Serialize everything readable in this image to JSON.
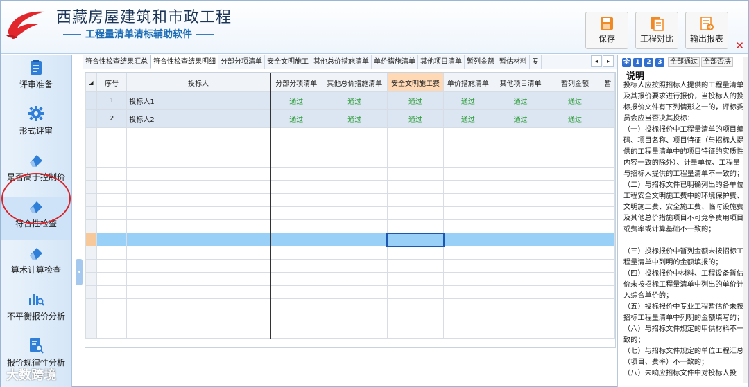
{
  "app": {
    "title": "西藏房屋建筑和市政工程",
    "subtitle": "工程量清单清标辅助软件"
  },
  "toolbar": {
    "save_label": "保存",
    "compare_label": "工程对比",
    "export_label": "输出报表",
    "close_label": "✕"
  },
  "sidebar": {
    "items": [
      {
        "label": "评审准备",
        "icon": "clipboard-icon"
      },
      {
        "label": "形式评审",
        "icon": "gear-icon"
      },
      {
        "label": "是否高于控制价",
        "icon": "eraser-icon"
      },
      {
        "label": "符合性检查",
        "icon": "eraser-icon"
      },
      {
        "label": "算术计算检查",
        "icon": "eraser-icon"
      },
      {
        "label": "不平衡报价分析",
        "icon": "bar-chart-search-icon"
      },
      {
        "label": "报价规律性分析",
        "icon": "document-search-icon"
      }
    ]
  },
  "tabs": [
    "符合性检查结果汇总",
    "符合性检查结果明细",
    "分部分项清单",
    "安全文明施工",
    "其他总价措施清单",
    "单价措施清单",
    "其他项目清单",
    "暂列金额",
    "暂估材料",
    "专"
  ],
  "tab_scroll": {
    "left": "◂",
    "right": "▸"
  },
  "grid": {
    "corner": "◢",
    "columns": [
      "序号",
      "投标人",
      "分部分项清单",
      "其他总价措施清单",
      "安全文明施工费",
      "单价措施清单",
      "其他项目清单",
      "暂列金额",
      "暂"
    ],
    "rows": [
      {
        "no": "1",
        "bidder": "投标人1",
        "cells": [
          "通过",
          "通过",
          "通过",
          "通过",
          "通过",
          "通过"
        ]
      },
      {
        "no": "2",
        "bidder": "投标人2",
        "cells": [
          "通过",
          "通过",
          "通过",
          "通过",
          "通过",
          "通过"
        ]
      }
    ]
  },
  "right_panel": {
    "pages": [
      "全",
      "1",
      "2",
      "3"
    ],
    "all_pass": "全部通过",
    "all_reject": "全部否决",
    "title": "说明",
    "paragraphs": [
      "投标人应按照招标人提供的工程量清单及其报价要求进行报价，当投标人的投标报价文件有下列情形之一的，评标委员会应当否决其投标：",
      "（一）投标报价中工程量清单的项目编码、项目名称、项目特征（与招标人提供的工程量清单中的项目特征的实质性内容一致的除外）、计量单位、工程量与招标人提供的工程量清单不一致的；",
      "（二）与招标文件已明确列出的各单位工程安全文明施工费中的环境保护费、文明施工费、安全施工费、临时设施费及其他总价措施项目不可竞争费用项目或费率或计算基础不一致的；",
      "（三）投标报价中暂列金额未按招标工程量清单中列明的金额填报的；",
      "（四）投标报价中材料、工程设备暂估价未按招标工程量清单中列出的单价计入综合单价的；",
      "（五）投标报价中专业工程暂估价未按招标工程量清单中列明的金额填写的；",
      "（六）与招标文件规定的甲供材料不一致的；",
      "（七）与招标文件规定的单位工程汇总（项目、费率）不一致的；",
      "（八）未响应招标文件中对投标人投"
    ]
  },
  "watermark": "大数跨境",
  "colors": {
    "accent": "#1f6db6",
    "highlight_header": "#ffd9b5",
    "selected_row": "#99d0f7",
    "pass_text": "#2a9c36",
    "annotation_circle": "#d9252a"
  }
}
